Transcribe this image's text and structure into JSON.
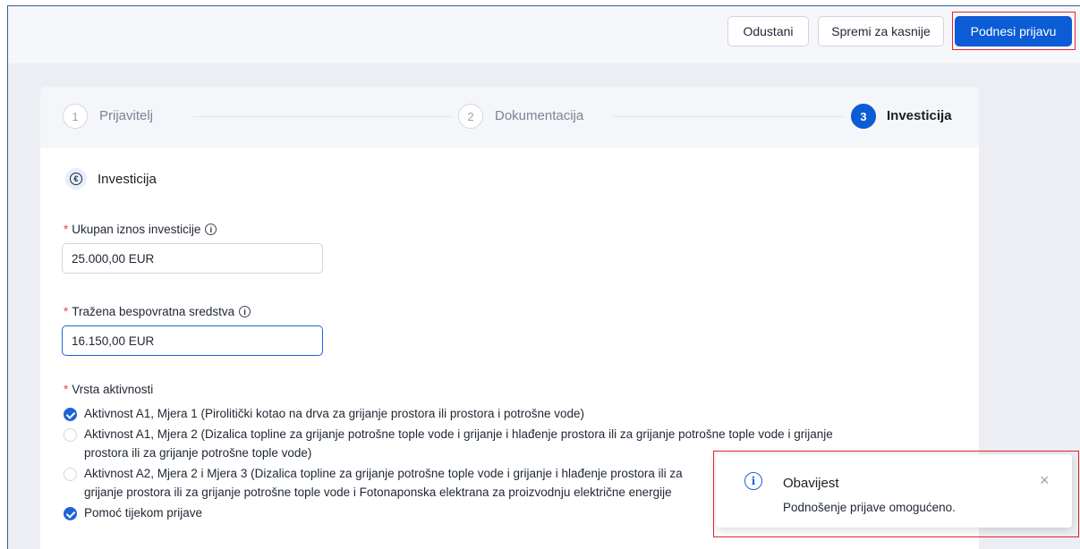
{
  "toolbar": {
    "cancel_label": "Odustani",
    "save_later_label": "Spremi za kasnije",
    "submit_label": "Podnesi prijavu"
  },
  "steps": [
    {
      "number": "1",
      "label": "Prijavitelj",
      "active": false
    },
    {
      "number": "2",
      "label": "Dokumentacija",
      "active": false
    },
    {
      "number": "3",
      "label": "Investicija",
      "active": true
    }
  ],
  "section": {
    "icon": "euro-icon",
    "icon_glyph": "€",
    "title": "Investicija"
  },
  "fields": {
    "required_marker": "*",
    "info_glyph": "i",
    "total_investment": {
      "label": "Ukupan iznos investicije",
      "value": "25.000,00 EUR"
    },
    "grants_requested": {
      "label": "Tražena bespovratna sredstva",
      "value": "16.150,00 EUR"
    }
  },
  "activities": {
    "label": "Vrsta aktivnosti",
    "options": [
      {
        "lines": [
          "Aktivnost A1, Mjera 1 (Pirolitički kotao na drva za grijanje prostora ili prostora i potrošne vode)"
        ],
        "checked": true
      },
      {
        "lines": [
          "Aktivnost A1, Mjera 2 (Dizalica topline za grijanje potrošne tople vode i grijanje i hlađenje prostora ili za grijanje potrošne tople vode i grijanje",
          "prostora ili za grijanje potrošne tople vode)"
        ],
        "checked": false
      },
      {
        "lines": [
          "Aktivnost A2, Mjera 2 i Mjera 3 (Dizalica topline za grijanje potrošne tople vode i grijanje i hlađenje prostora ili za",
          "grijanje prostora ili za grijanje potrošne tople vode i Fotonaponska elektrana za proizvodnju električne energije"
        ],
        "checked": false
      },
      {
        "lines": [
          "Pomoć tijekom prijave"
        ],
        "checked": true
      }
    ]
  },
  "notification": {
    "icon_glyph": "i",
    "title": "Obavijest",
    "message": "Podnošenje prijave omogućeno.",
    "close_glyph": "×"
  },
  "colors": {
    "primary": "#0b5cd5",
    "highlight": "#e0262a",
    "required": "#e0454a"
  }
}
